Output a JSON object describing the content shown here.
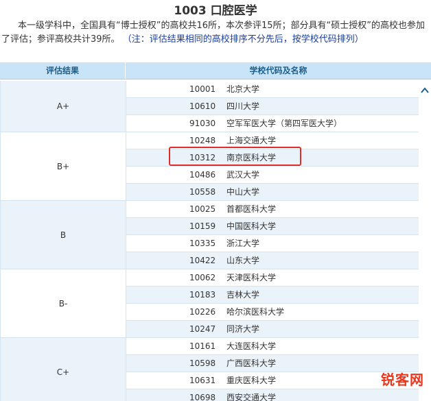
{
  "title": "1003 口腔医学",
  "intro": {
    "text": "本一级学科中，全国具有“博士授权”的高校共16所，本次参评15所；部分具有“硕士授权”的高校也参加了评估；参评高校共计39所。",
    "note": "（注：评估结果相同的高校排序不分先后，按学校代码排列）"
  },
  "table": {
    "header_grade": "评估结果",
    "header_school": "学校代码及名称",
    "groups": [
      {
        "grade": "A+",
        "rows": [
          {
            "code": "10001",
            "name": "北京大学"
          },
          {
            "code": "10610",
            "name": "四川大学"
          },
          {
            "code": "91030",
            "name": "空军军医大学（第四军医大学）"
          }
        ]
      },
      {
        "grade": "B+",
        "rows": [
          {
            "code": "10248",
            "name": "上海交通大学"
          },
          {
            "code": "10312",
            "name": "南京医科大学"
          },
          {
            "code": "10486",
            "name": "武汉大学"
          },
          {
            "code": "10558",
            "name": "中山大学"
          }
        ]
      },
      {
        "grade": "B",
        "rows": [
          {
            "code": "10025",
            "name": "首都医科大学"
          },
          {
            "code": "10159",
            "name": "中国医科大学"
          },
          {
            "code": "10335",
            "name": "浙江大学"
          },
          {
            "code": "10422",
            "name": "山东大学"
          }
        ]
      },
      {
        "grade": "B-",
        "rows": [
          {
            "code": "10062",
            "name": "天津医科大学"
          },
          {
            "code": "10183",
            "name": "吉林大学"
          },
          {
            "code": "10226",
            "name": "哈尔滨医科大学"
          },
          {
            "code": "10247",
            "name": "同济大学"
          }
        ]
      },
      {
        "grade": "C+",
        "rows": [
          {
            "code": "10161",
            "name": "大连医科大学"
          },
          {
            "code": "10598",
            "name": "广西医科大学"
          },
          {
            "code": "10631",
            "name": "重庆医科大学"
          },
          {
            "code": "10698",
            "name": "西安交通大学"
          }
        ]
      }
    ]
  },
  "watermark": "锐客网",
  "colors": {
    "header_bg": "#c9e4f6",
    "alt_row": "#eaf3fa",
    "highlight": "#e02b2b",
    "note": "#1a3d9e"
  }
}
